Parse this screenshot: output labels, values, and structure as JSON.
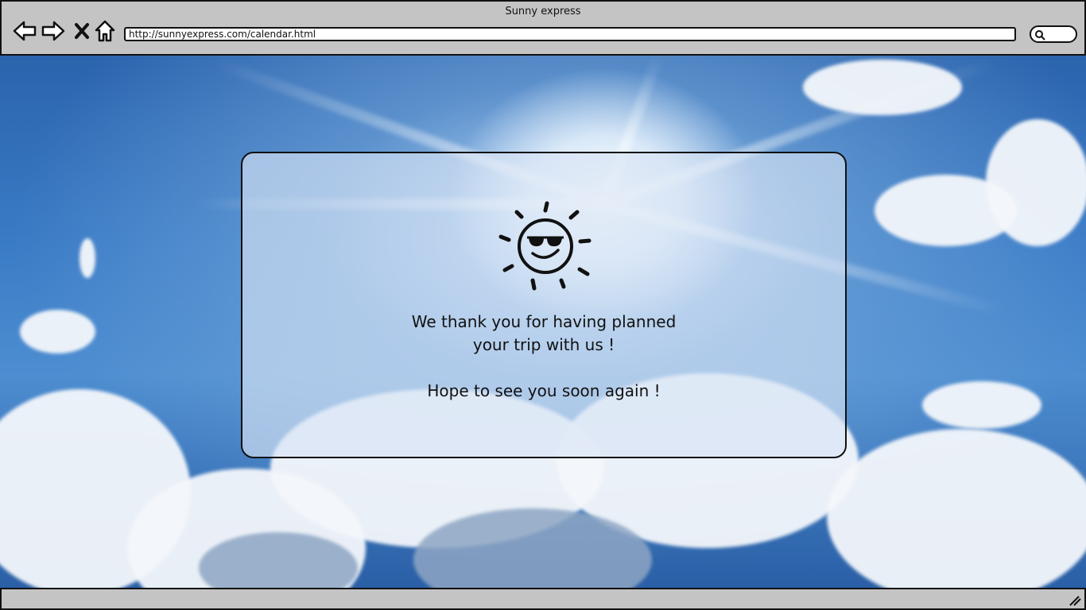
{
  "window": {
    "title": "Sunny express"
  },
  "toolbar": {
    "back_icon": "arrow-left-icon",
    "forward_icon": "arrow-right-icon",
    "stop_icon": "close-icon",
    "home_icon": "home-icon",
    "url": "http://sunnyexpress.com/calendar.html",
    "search_icon": "search-icon"
  },
  "dialog": {
    "icon": "sun-sunglasses-icon",
    "line1": "We thank you for having planned",
    "line2": "your trip with us !",
    "line3": "Hope to see you soon again !"
  },
  "status_bar": {
    "resize_icon": "resize-grip-icon"
  },
  "colors": {
    "chrome": "#c4c4c4",
    "sky": "#3a7bc6",
    "text": "#111111"
  }
}
